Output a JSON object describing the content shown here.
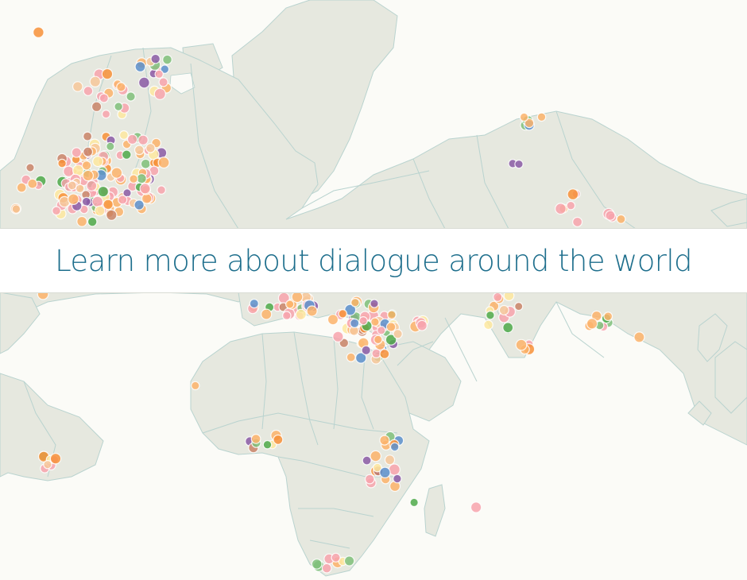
{
  "banner": {
    "label": "Learn more about dialogue around the world"
  },
  "map": {
    "colors": {
      "background": "#fbfbf7",
      "land": "#e6e8df",
      "border": "#b9d3cf",
      "banner_text": "#1d6e8c"
    },
    "marker_palette": [
      "#f7a3ad",
      "#fbb36b",
      "#f79038",
      "#4ea94a",
      "#7fc07a",
      "#5b8fcc",
      "#8a5aa6",
      "#fde7a0",
      "#f6c79a",
      "#c98469"
    ]
  }
}
